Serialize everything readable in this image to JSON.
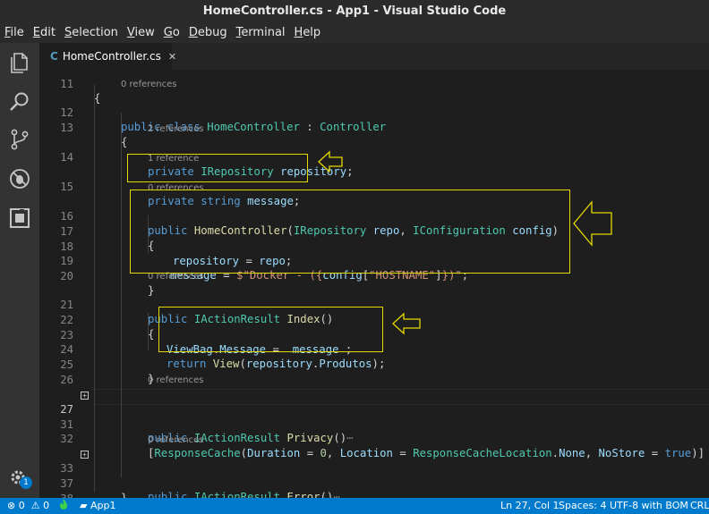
{
  "window": {
    "title": "HomeController.cs - App1 - Visual Studio Code"
  },
  "menu": [
    "File",
    "Edit",
    "Selection",
    "View",
    "Go",
    "Debug",
    "Terminal",
    "Help"
  ],
  "tab": {
    "file_icon": "C",
    "label": "HomeController.cs",
    "close": "✕"
  },
  "activity": {
    "settings_badge": "1"
  },
  "editor": {
    "top_brace": "{",
    "lines": [
      {
        "n": "12",
        "lens": "0 references"
      },
      {
        "n": "13"
      },
      {
        "n": "14",
        "lens": "2 references"
      },
      {
        "n": "15",
        "lens": "1 reference"
      },
      {
        "n": "16",
        "lens": "0 references"
      },
      {
        "n": "17"
      },
      {
        "n": "18"
      },
      {
        "n": "19"
      },
      {
        "n": "20"
      },
      {
        "n": "21",
        "lens": "0 references"
      },
      {
        "n": "22"
      },
      {
        "n": "23"
      },
      {
        "n": "24"
      },
      {
        "n": "25"
      },
      {
        "n": "26"
      },
      {
        "n": "27",
        "lens": "0 references"
      },
      {
        "n": "31"
      },
      {
        "n": "32"
      },
      {
        "n": "33",
        "lens": "0 references"
      },
      {
        "n": "37"
      },
      {
        "n": "38"
      }
    ],
    "partial_line_number": "11",
    "t": {
      "public": "public",
      "class": "class",
      "private": "private",
      "string": "string",
      "return": "return",
      "true": "true",
      "HomeController": "HomeController",
      "Controller": "Controller",
      "IRepository": "IRepository",
      "IConfiguration": "IConfiguration",
      "IActionResult": "IActionResult",
      "ViewBag": "ViewBag",
      "ResponseCache": "ResponseCache",
      "ResponseCacheLocation": "ResponseCacheLocation",
      "repository": "repository",
      "message": "message",
      "repo": "repo",
      "config": "config",
      "Message": "Message",
      "Produtos": "Produtos",
      "Duration": "Duration",
      "Location": "Location",
      "None": "None",
      "NoStore": "NoStore",
      "Index": "Index",
      "Privacy": "Privacy",
      "Error": "Error",
      "View": "View",
      "docker_str": "$\"Docker - ({",
      "hostname_str": "\"HOSTNAME\"",
      "close_str": "})\"",
      "zero": "0",
      "ellipsis": "⋯"
    }
  },
  "status": {
    "errors": "0",
    "warnings": "0",
    "folder": "App1",
    "position": "Ln 27, Col 1",
    "spaces": "Spaces: 4",
    "encoding": "UTF-8 with BOM",
    "eol": "CRLF"
  },
  "colors": {
    "highlight_box": "#e5d800",
    "status_bar": "#007acc",
    "accent_green": "#4ec9b0"
  }
}
